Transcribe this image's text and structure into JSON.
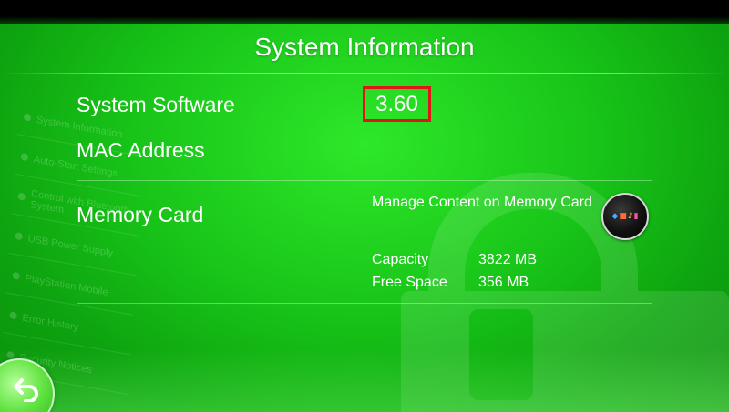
{
  "header": {
    "title": "System Information"
  },
  "rows": {
    "system_software": {
      "label": "System Software",
      "value": "3.60"
    },
    "mac_address": {
      "label": "MAC Address"
    },
    "memory_card": {
      "label": "Memory Card",
      "manage_label": "Manage Content on Memory Card",
      "capacity_label": "Capacity",
      "capacity_value": "3822 MB",
      "free_space_label": "Free Space",
      "free_space_value": "356 MB",
      "app_icon": "content-manager-icon"
    }
  },
  "background_menu": {
    "items": [
      "System Information",
      "Auto-Start Settings",
      "Control with Bluetooth System",
      "USB Power Supply",
      "PlayStation Mobile",
      "Error History",
      "Security Notices"
    ]
  },
  "footer": {
    "back_icon": "back-arrow-icon"
  },
  "colors": {
    "background": "#18c418",
    "highlight_border": "#e01515",
    "text": "#ffffff"
  }
}
